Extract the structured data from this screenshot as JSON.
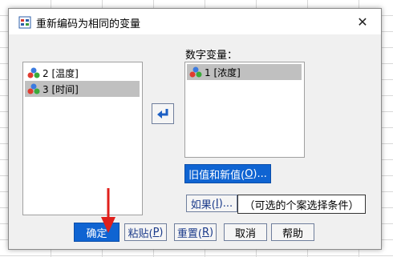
{
  "window": {
    "title": "重新编码为相同的变量"
  },
  "source_list": {
    "items": [
      {
        "label": "2 [温度]",
        "selected": false
      },
      {
        "label": "3 [时间]",
        "selected": true
      }
    ]
  },
  "numeric_variables": {
    "label": "数字变量：",
    "items": [
      {
        "label": "1 [浓度]",
        "selected": true
      }
    ]
  },
  "buttons": {
    "old_new_label": "旧值和新值(",
    "old_new_mnemonic": "O",
    "old_new_suffix": ")...",
    "if_label": "如果(",
    "if_mnemonic": "I",
    "if_suffix": ")...",
    "ok": "确定",
    "paste_label": "粘贴(",
    "paste_mnemonic": "P",
    "paste_suffix": ")",
    "reset_label": "重置(",
    "reset_mnemonic": "R",
    "reset_suffix": ")",
    "cancel": "取消",
    "help": "帮助"
  },
  "condition_text": "（可选的个案选择条件）",
  "colors": {
    "primary": "#0f64d2",
    "annotation_arrow": "#e0201c"
  }
}
